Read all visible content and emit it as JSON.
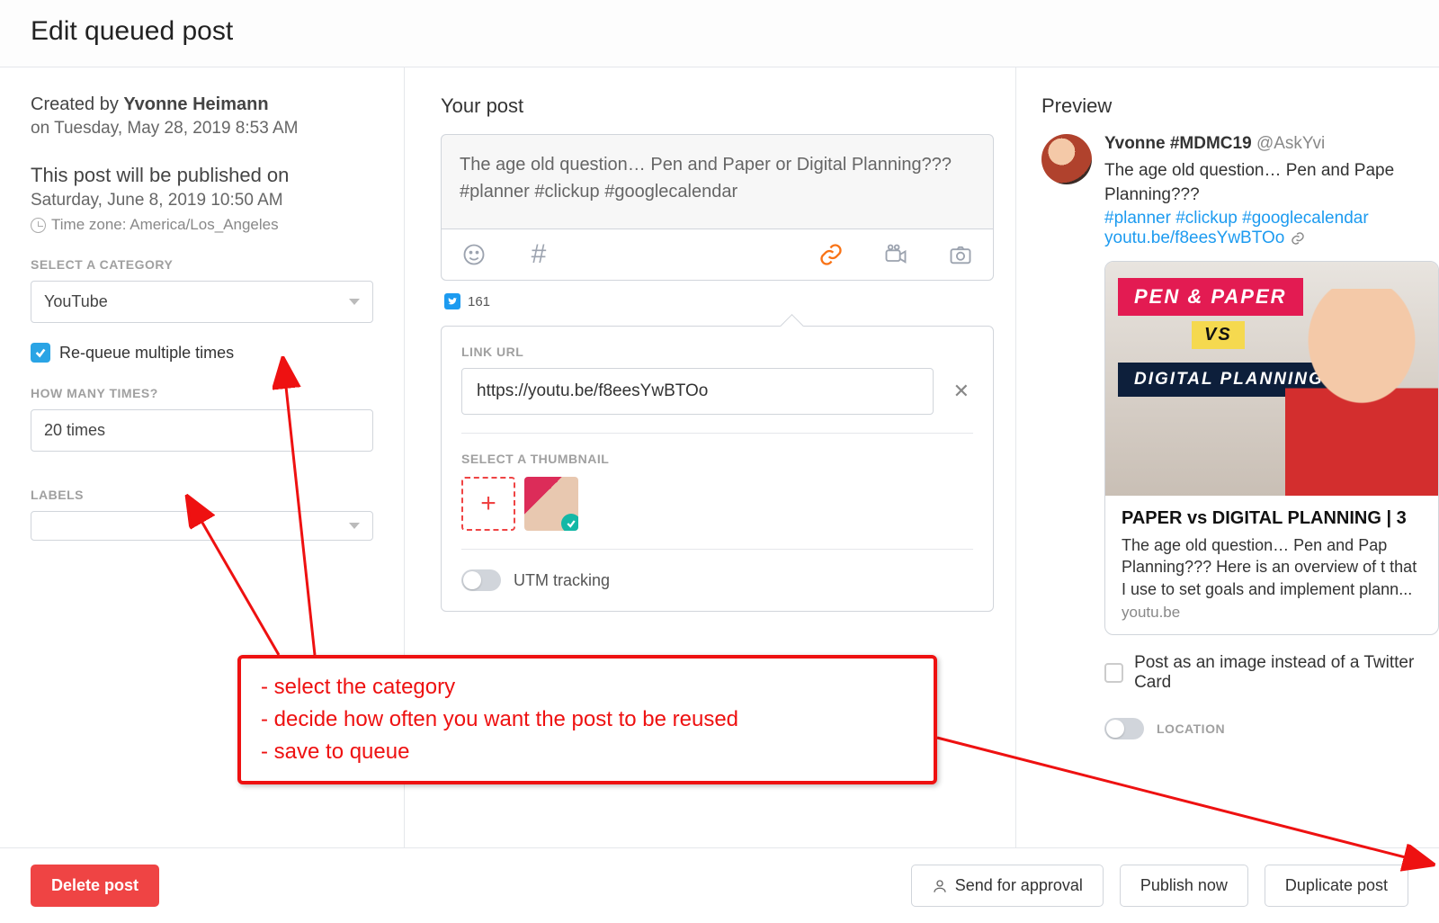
{
  "header": {
    "title": "Edit queued post"
  },
  "left": {
    "created_prefix": "Created by ",
    "creator": "Yvonne Heimann",
    "created_on": "on Tuesday, May 28, 2019 8:53 AM",
    "publish_heading": "This post will be published on",
    "publish_time": "Saturday, June 8, 2019 10:50 AM",
    "timezone": "Time zone: America/Los_Angeles",
    "cat_label": "SELECT A CATEGORY",
    "category": "YouTube",
    "requeue_label": "Re-queue multiple times",
    "times_label": "HOW MANY TIMES?",
    "times_value": "20 times",
    "labels_label": "LABELS"
  },
  "mid": {
    "heading": "Your post",
    "post_text": "The age old question… Pen and Paper or Digital Planning???\n#planner #clickup #googlecalendar",
    "char_count": "161",
    "link_label": "LINK URL",
    "link_url": "https://youtu.be/f8eesYwBTOo",
    "thumb_label": "SELECT A THUMBNAIL",
    "utm_label": "UTM tracking"
  },
  "right": {
    "heading": "Preview",
    "display_name": "Yvonne #MDMC19",
    "handle": "@AskYvi",
    "text_line1": "The age old question… Pen and Pape",
    "text_line2": "Planning???",
    "hashtags": "#planner #clickup #googlecalendar",
    "short_url": "youtu.be/f8eesYwBTOo",
    "banner1": "PEN & PAPER",
    "banner_vs": "VS",
    "banner2": "DIGITAL PLANNING",
    "card_title": "PAPER vs DIGITAL PLANNING | 3",
    "card_desc": "The age old question… Pen and Pap Planning??? Here is an overview of t that I use to set goals and implement plann...",
    "card_host": "youtu.be",
    "img_option": "Post as an image instead of a Twitter Card",
    "location_label": "LOCATION"
  },
  "footer": {
    "delete": "Delete post",
    "approval": "Send for approval",
    "publish": "Publish now",
    "duplicate": "Duplicate post"
  },
  "annotation": {
    "line1": "- select the category",
    "line2": "- decide how often you want the post to be reused",
    "line3": "- save to queue"
  }
}
